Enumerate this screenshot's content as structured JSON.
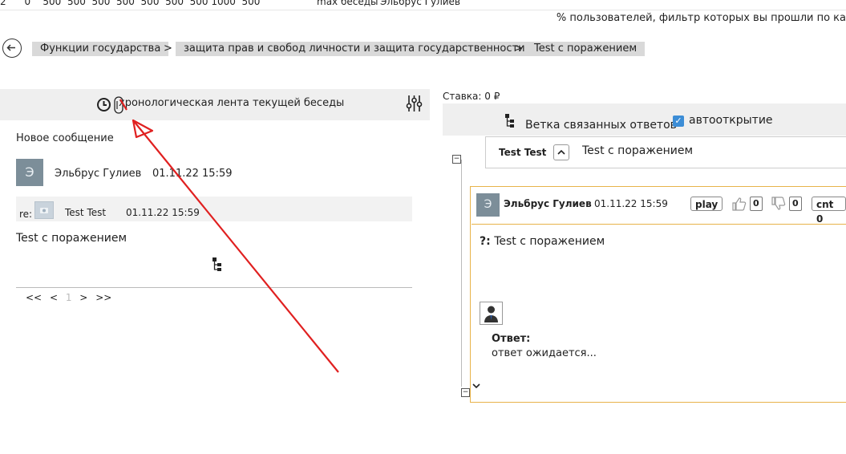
{
  "top": {
    "numbers": "2      0    500  500  500  500  500  500  500 1000  500",
    "max_label": "max беседы",
    "author": "Эльбрус Гулиев",
    "note": "% пользователей, фильтр которых вы прошли по ка"
  },
  "breadcrumb": {
    "items": [
      "Функции государства",
      "защита прав и свобод личности и защита государственности",
      "Test с поражением"
    ],
    "separator": ">"
  },
  "left": {
    "title": "хронологическая лента текущей беседы",
    "new_message": "Новое сообщение",
    "post": {
      "avatar_letter": "Э",
      "author": "Эльбрус Гулиев",
      "date": "01.11.22 15:59"
    },
    "reply": {
      "prefix": "re:",
      "author": "Test Test",
      "date": "01.11.22 15:59"
    },
    "text": "Test с поражением",
    "pager": {
      "first": "<<",
      "prev": "<",
      "current": "1",
      "next": ">",
      "last": ">>"
    }
  },
  "right": {
    "stake": "Ставка: 0 ₽",
    "branch_label": "Ветка связанных ответов",
    "autoopen_label": "автооткрытие",
    "autoopen_checked": true,
    "topic": {
      "author": "Test Test",
      "title": "Test с поражением"
    },
    "message": {
      "avatar_letter": "Э",
      "author": "Эльбрус Гулиев",
      "date": "01.11.22 15:59",
      "play": "play",
      "likes": "0",
      "dislikes": "0",
      "cnt": "cnt 0",
      "q_prefix": "?:",
      "question": "Test с поражением",
      "answer_label": "Ответ:",
      "answer_text": "ответ ожидается..."
    }
  },
  "annotation_color": "#e02020"
}
